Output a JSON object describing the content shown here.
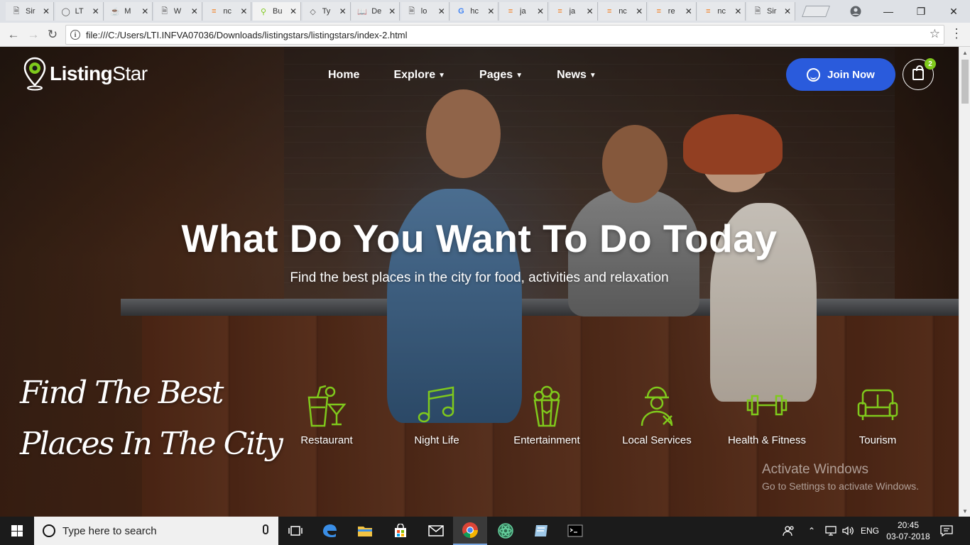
{
  "browser": {
    "tabs": [
      {
        "title": "Sir",
        "icon": "page-icon"
      },
      {
        "title": "LT",
        "icon": "github-icon"
      },
      {
        "title": "M",
        "icon": "cup-icon"
      },
      {
        "title": "W",
        "icon": "page-icon"
      },
      {
        "title": "nc",
        "icon": "stack-icon"
      },
      {
        "title": "Bu",
        "icon": "pin-icon"
      },
      {
        "title": "Ty",
        "icon": "diamond-icon"
      },
      {
        "title": "De",
        "icon": "book-icon"
      },
      {
        "title": "lo",
        "icon": "page-icon"
      },
      {
        "title": "hc",
        "icon": "google-icon"
      },
      {
        "title": "ja",
        "icon": "stack-icon"
      },
      {
        "title": "ja",
        "icon": "stack-icon"
      },
      {
        "title": "nc",
        "icon": "stack-icon"
      },
      {
        "title": "re",
        "icon": "stack-icon"
      },
      {
        "title": "nc",
        "icon": "stack-icon"
      },
      {
        "title": "Sir",
        "icon": "page-icon"
      }
    ],
    "active_tab_index": 5,
    "url": "file:///C:/Users/LTI.INFVA07036/Downloads/listingstars/listingstars/index-2.html"
  },
  "site": {
    "brand_bold": "Listing",
    "brand_light": "Star",
    "nav": [
      {
        "label": "Home",
        "dropdown": false
      },
      {
        "label": "Explore",
        "dropdown": true
      },
      {
        "label": "Pages",
        "dropdown": true
      },
      {
        "label": "News",
        "dropdown": true
      }
    ],
    "join_label": "Join Now",
    "cart_count": "2",
    "accent_color": "#2a5bdc",
    "icon_color": "#7fc91c"
  },
  "hero": {
    "title": "What Do You Want To Do Today",
    "subtitle": "Find the best places in the city for food, activities and relaxation",
    "script_line1": "Find The Best",
    "script_line2": "Places In The City"
  },
  "categories": [
    {
      "label": "Restaurant",
      "icon": "drinks-icon"
    },
    {
      "label": "Night Life",
      "icon": "music-note-icon"
    },
    {
      "label": "Entertainment",
      "icon": "popcorn-icon"
    },
    {
      "label": "Local Services",
      "icon": "worker-icon"
    },
    {
      "label": "Health & Fitness",
      "icon": "dumbbell-icon"
    },
    {
      "label": "Tourism",
      "icon": "sofa-icon"
    }
  ],
  "watermark": {
    "line1": "Activate Windows",
    "line2": "Go to Settings to activate Windows."
  },
  "taskbar": {
    "search_placeholder": "Type here to search",
    "language": "ENG",
    "time": "20:45",
    "date": "03-07-2018"
  }
}
